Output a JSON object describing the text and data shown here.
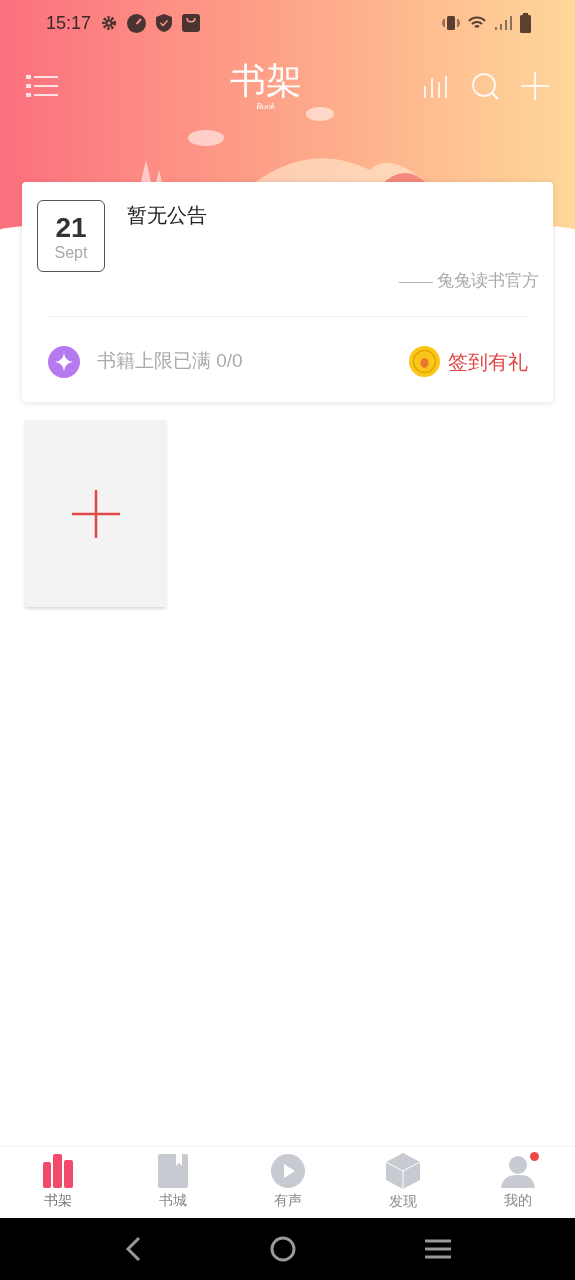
{
  "status_bar": {
    "time": "15:17"
  },
  "header": {
    "title": "书架",
    "subtitle": "Book"
  },
  "notice": {
    "day": "21",
    "month": "Sept",
    "text": "暂无公告",
    "signature": "—— 兔兔读书官方"
  },
  "book_limit": {
    "label": "书籍上限已满",
    "count": "0/0"
  },
  "check_in": {
    "label": "签到有礼"
  },
  "tabs": [
    {
      "label": "书架",
      "selected": true,
      "badge": false
    },
    {
      "label": "书城",
      "selected": false,
      "badge": false
    },
    {
      "label": "有声",
      "selected": false,
      "badge": false
    },
    {
      "label": "发现",
      "selected": false,
      "badge": false
    },
    {
      "label": "我的",
      "selected": false,
      "badge": true
    }
  ]
}
